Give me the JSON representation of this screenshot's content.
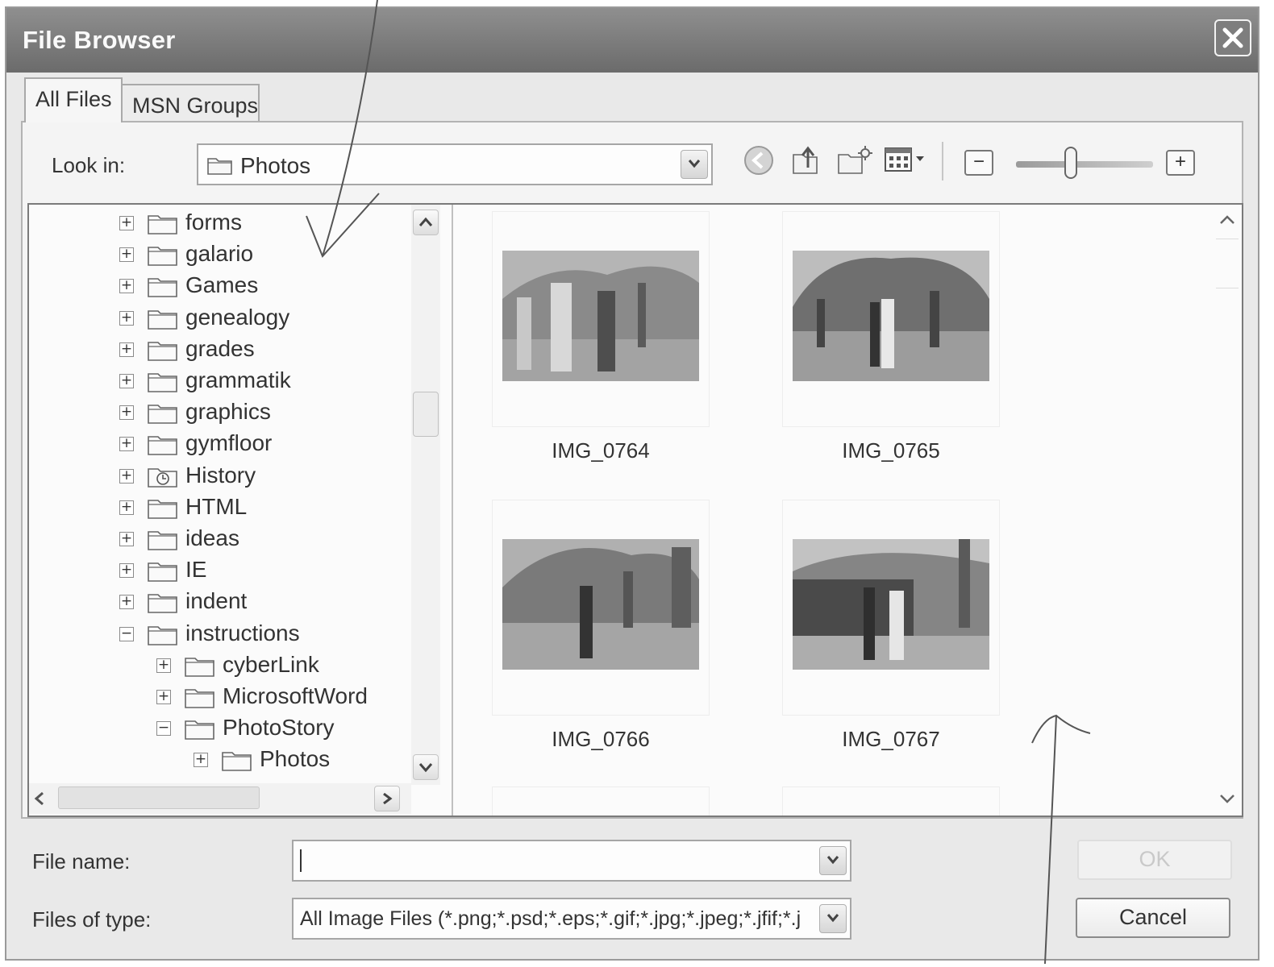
{
  "window": {
    "title": "File Browser"
  },
  "tabs": [
    {
      "label": "All Files",
      "active": true
    },
    {
      "label": "MSN Groups",
      "active": false
    }
  ],
  "toolbar": {
    "look_in_label": "Look in:",
    "look_in_value": "Photos",
    "icons": [
      "back-icon",
      "up-folder-icon",
      "new-folder-icon",
      "views-menu-icon"
    ],
    "zoom_out_label": "−",
    "zoom_in_label": "+",
    "zoom_level": 0.4
  },
  "tree": {
    "items": [
      {
        "label": "forms",
        "level": 0,
        "expander": "+",
        "icon": "folder-icon"
      },
      {
        "label": "galario",
        "level": 0,
        "expander": "+",
        "icon": "folder-icon"
      },
      {
        "label": "Games",
        "level": 0,
        "expander": "+",
        "icon": "folder-icon"
      },
      {
        "label": "genealogy",
        "level": 0,
        "expander": "+",
        "icon": "folder-icon"
      },
      {
        "label": "grades",
        "level": 0,
        "expander": "+",
        "icon": "folder-icon"
      },
      {
        "label": "grammatik",
        "level": 0,
        "expander": "+",
        "icon": "folder-icon"
      },
      {
        "label": "graphics",
        "level": 0,
        "expander": "+",
        "icon": "folder-icon"
      },
      {
        "label": "gymfloor",
        "level": 0,
        "expander": "+",
        "icon": "folder-icon"
      },
      {
        "label": "History",
        "level": 0,
        "expander": "+",
        "icon": "history-folder-icon"
      },
      {
        "label": "HTML",
        "level": 0,
        "expander": "+",
        "icon": "folder-icon"
      },
      {
        "label": "ideas",
        "level": 0,
        "expander": "+",
        "icon": "folder-icon"
      },
      {
        "label": "IE",
        "level": 0,
        "expander": "+",
        "icon": "folder-icon"
      },
      {
        "label": "indent",
        "level": 0,
        "expander": "+",
        "icon": "folder-icon"
      },
      {
        "label": "instructions",
        "level": 0,
        "expander": "−",
        "icon": "folder-icon"
      },
      {
        "label": "cyberLink",
        "level": 1,
        "expander": "+",
        "icon": "folder-icon"
      },
      {
        "label": "MicrosoftWord",
        "level": 1,
        "expander": "+",
        "icon": "folder-icon"
      },
      {
        "label": "PhotoStory",
        "level": 1,
        "expander": "−",
        "icon": "folder-icon"
      },
      {
        "label": "Photos",
        "level": 2,
        "expander": "+",
        "icon": "folder-icon",
        "selected": true
      }
    ]
  },
  "thumbnails": [
    {
      "caption": "IMG_0764"
    },
    {
      "caption": "IMG_0765"
    },
    {
      "caption": "IMG_0766"
    },
    {
      "caption": "IMG_0767"
    }
  ],
  "file_name": {
    "label": "File name:",
    "value": ""
  },
  "file_type": {
    "label": "Files of type:",
    "value": "All Image Files (*.png;*.psd;*.eps;*.gif;*.jpg;*.jpeg;*.jfif;*.j"
  },
  "buttons": {
    "ok": "OK",
    "cancel": "Cancel"
  }
}
